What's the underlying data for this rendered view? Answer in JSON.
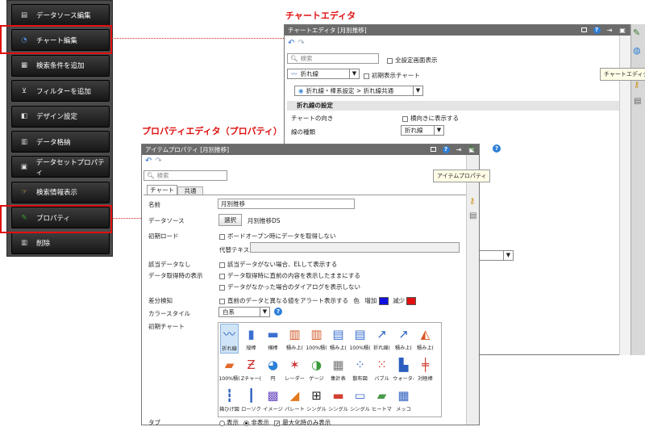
{
  "menu": {
    "items": [
      {
        "label": "データソース編集",
        "icon": "datasource-icon"
      },
      {
        "label": "チャート編集",
        "icon": "chart-search-icon"
      },
      {
        "label": "検索条件を追加",
        "icon": "search-condition-icon"
      },
      {
        "label": "フィルターを追加",
        "icon": "filter-icon"
      },
      {
        "label": "デザイン設定",
        "icon": "design-icon"
      },
      {
        "label": "データ格納",
        "icon": "data-store-icon"
      },
      {
        "label": "データセットプロパティ",
        "icon": "dataset-icon"
      },
      {
        "label": "検索情報表示",
        "icon": "search-info-icon"
      },
      {
        "label": "プロパティ",
        "icon": "pen-icon"
      },
      {
        "label": "削除",
        "icon": "trash-icon"
      }
    ]
  },
  "captions": {
    "chart_editor": "チャートエディタ",
    "property_editor": "プロパティエディタ（プロパティ）"
  },
  "chart_editor": {
    "title": "チャートエディタ [月別推移]",
    "search_placeholder": "検索",
    "show_all": "全設定画面表示",
    "chart_type": "折れ線",
    "initial_chart": "初期表示チャート",
    "breadcrumb": "折れ線・棒系設定 > 折れ線共通",
    "section": "折れ線の設定",
    "orientation_label": "チャートの向き",
    "orientation_value": "横向きに表示する",
    "line_type_label": "線の種類",
    "line_type_value": "折れ線",
    "tooltip": "チャートエディタ"
  },
  "property_editor": {
    "title": "アイテムプロパティ [月別推移]",
    "search_placeholder": "検索",
    "tabs": [
      "チャート",
      "共通"
    ],
    "tooltip": "アイテムプロパティ",
    "rows": {
      "name_label": "名前",
      "name_value": "月別推移",
      "datasource_label": "データソース",
      "datasource_button": "選択",
      "datasource_value": "月別推移DS",
      "initial_load_label": "初期ロード",
      "initial_load_check": "ボードオープン時にデータを取得しない",
      "alt_text_label": "代替テキスト",
      "no_data_label": "該当データなし",
      "no_data_check": "該当データがない場合、ELして表示する",
      "fetch_label": "データ取得時の表示",
      "fetch_check1": "データ取得時に直前の内容を表示したままにする",
      "fetch_check2": "データがなかった場合のダイアログを表示しない",
      "diff_label": "差分検知",
      "diff_check": "直前のデータと異なる値をアラート表示する",
      "diff_color": "色",
      "diff_up": "増加",
      "diff_down": "減少",
      "diff_up_color": "#1010e0",
      "diff_down_color": "#e01010",
      "color_style_label": "カラースタイル",
      "color_style_value": "白系",
      "initial_chart_label": "初期チャート",
      "tab_label": "タブ",
      "tab_show": "表示",
      "tab_hide": "非表示",
      "tab_max": "最大化時のみ表示"
    },
    "chart_types": [
      "折れ線",
      "縦棒",
      "横棒",
      "積み上(",
      "100%積(",
      "積み上(",
      "100%積(",
      "折れ線(",
      "積み上(",
      "積み上(",
      "100%積(",
      "Zチャー(",
      "円",
      "レーダー",
      "ゲージ",
      "集計表",
      "散布図",
      "バブル",
      "ウォータ-",
      "対極棒",
      "箱ひげ図",
      "ローソク",
      "イメージ",
      "パレート",
      "シングル",
      "シングル",
      "シングル",
      "ヒートマ",
      "メッコ"
    ]
  }
}
